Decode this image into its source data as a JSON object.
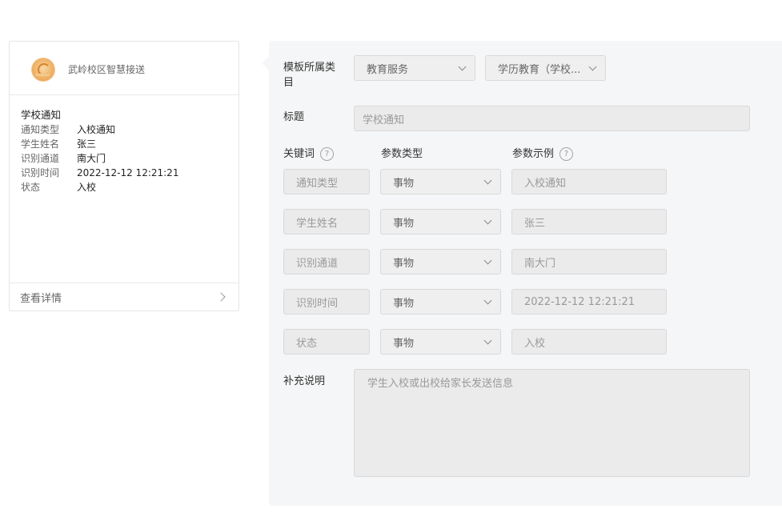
{
  "preview": {
    "account_name": "武岭校区智慧接送",
    "title": "学校通知",
    "fields": [
      {
        "label": "通知类型",
        "value": "入校通知"
      },
      {
        "label": "学生姓名",
        "value": "张三"
      },
      {
        "label": "识别通道",
        "value": "南大门"
      },
      {
        "label": "识别时间",
        "value": "2022-12-12 12:21:21"
      },
      {
        "label": "状态",
        "value": "入校"
      }
    ],
    "details_link": "查看详情"
  },
  "form": {
    "category_label": "模板所属类目",
    "category_primary": "教育服务",
    "category_secondary": "学历教育（学校...",
    "title_label": "标题",
    "title_value": "学校通知",
    "col_keyword": "关键词",
    "col_param_type": "参数类型",
    "col_param_example": "参数示例",
    "help_glyph": "?",
    "params": [
      {
        "keyword": "通知类型",
        "type": "事物",
        "example": "入校通知"
      },
      {
        "keyword": "学生姓名",
        "type": "事物",
        "example": "张三"
      },
      {
        "keyword": "识别通道",
        "type": "事物",
        "example": "南大门"
      },
      {
        "keyword": "识别时间",
        "type": "事物",
        "example": "2022-12-12 12:21:21"
      },
      {
        "keyword": "状态",
        "type": "事物",
        "example": "入校"
      }
    ],
    "notes_label": "补充说明",
    "notes_value": "学生入校或出校给家长发送信息"
  },
  "colors": {
    "panel_bg": "#f5f6f7",
    "input_bg": "#ebebeb",
    "border": "#d9d9d9"
  }
}
